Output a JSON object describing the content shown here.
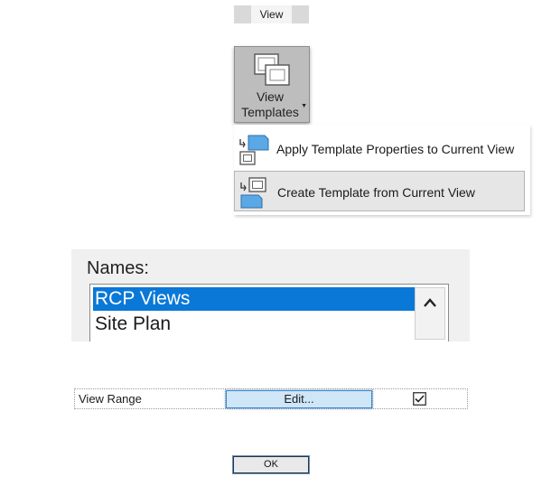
{
  "ribbon": {
    "tab_label": "View",
    "view_templates_button": {
      "line1": "View",
      "line2": "Templates",
      "icon": "view-templates-icon",
      "dropdown_icon": "dropdown-arrow-icon"
    }
  },
  "menu": {
    "items": [
      {
        "label": "Apply Template Properties to Current View",
        "icon": "apply-template-icon",
        "highlighted": false
      },
      {
        "label": "Create Template from Current View",
        "icon": "create-template-icon",
        "highlighted": true
      }
    ]
  },
  "names_panel": {
    "label": "Names:",
    "items": [
      {
        "label": "RCP Views",
        "selected": true
      },
      {
        "label": "Site Plan",
        "selected": false
      }
    ],
    "scroll_icon": "chevron-up-icon",
    "selection_color": "#0a78d7"
  },
  "properties": {
    "row_label": "View Range",
    "edit_button": "Edit...",
    "include_checked": true
  },
  "dialog": {
    "ok_label": "OK"
  }
}
